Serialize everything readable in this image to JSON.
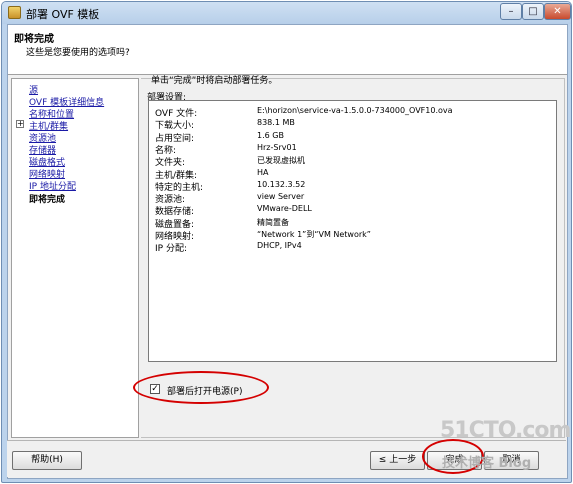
{
  "window": {
    "title": "部署 OVF 模板",
    "minimize_glyph": "–",
    "maximize_glyph": "□",
    "close_glyph": "✕"
  },
  "header": {
    "title": "即将完成",
    "subtitle": "这些是您要使用的选项吗?"
  },
  "nav": {
    "items": [
      {
        "label": "源"
      },
      {
        "label": "OVF 模板详细信息"
      },
      {
        "label": "名称和位置"
      },
      {
        "label": "主机/群集"
      },
      {
        "label": "资源池"
      },
      {
        "label": "存储器"
      },
      {
        "label": "磁盘格式"
      },
      {
        "label": "网络映射"
      },
      {
        "label": "IP 地址分配"
      },
      {
        "label": "即将完成"
      }
    ],
    "expander_glyph": "+"
  },
  "main": {
    "instruction": "单击“完成”时将启动部署任务。",
    "settings_label": "部署设置:",
    "settings": [
      {
        "key": "OVF 文件:",
        "value": "E:\\horizon\\service-va-1.5.0.0-734000_OVF10.ova"
      },
      {
        "key": "下载大小:",
        "value": "838.1 MB"
      },
      {
        "key": "占用空间:",
        "value": "1.6 GB"
      },
      {
        "key": "名称:",
        "value": "Hrz-Srv01"
      },
      {
        "key": "文件夹:",
        "value": "已发现虚拟机"
      },
      {
        "key": "主机/群集:",
        "value": "HA"
      },
      {
        "key": "特定的主机:",
        "value": "10.132.3.52"
      },
      {
        "key": "资源池:",
        "value": "view Server"
      },
      {
        "key": "数据存储:",
        "value": "VMware-DELL"
      },
      {
        "key": "磁盘置备:",
        "value": "精简置备"
      },
      {
        "key": "网络映射:",
        "value": "“Network 1”到“VM Network”"
      },
      {
        "key": "IP 分配:",
        "value": "DHCP, IPv4"
      }
    ],
    "power_on": {
      "label": "部署后打开电源(P)",
      "checked": true,
      "check_glyph": "✓"
    }
  },
  "footer": {
    "help_label": "帮助(H)",
    "back_label": "≤ 上一步",
    "finish_label": "完成",
    "cancel_label": "取消"
  },
  "watermark": {
    "line1": "51CTO.com",
    "line2": "技术博客 Blog"
  }
}
